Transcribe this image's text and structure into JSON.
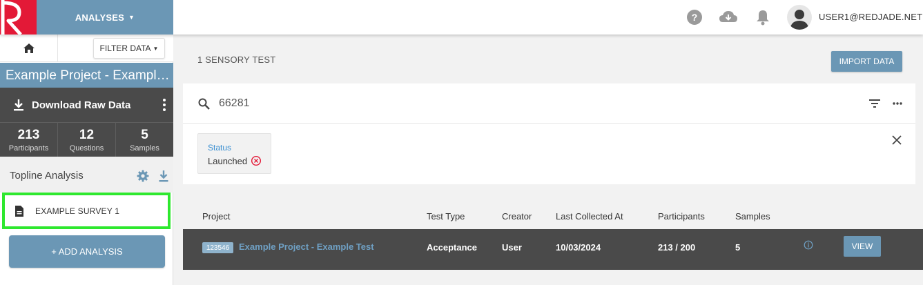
{
  "header": {
    "menu_label": "ANALYSES",
    "user": "USER1@REDJADE.NET",
    "brand_color": "#e31937",
    "accent_color": "#6b97b5"
  },
  "sidebar": {
    "filter_label": "FILTER DATA",
    "project_title": "Example Project - Example Test",
    "download_label": "Download Raw Data",
    "stats": [
      {
        "value": "213",
        "label": "Participants"
      },
      {
        "value": "12",
        "label": "Questions"
      },
      {
        "value": "5",
        "label": "Samples"
      }
    ],
    "section_label": "Topline Analysis",
    "survey_item": "EXAMPLE SURVEY 1",
    "add_label": "+ ADD ANALYSIS"
  },
  "main": {
    "count_label": "1 SENSORY TEST",
    "import_label": "IMPORT DATA",
    "search_value": "66281",
    "filter_chip": {
      "label": "Status",
      "value": "Launched"
    },
    "columns": [
      "Project",
      "Test Type",
      "Creator",
      "Last Collected At",
      "Participants",
      "Samples"
    ],
    "rows": [
      {
        "id": "123546",
        "project": "Example Project - Example Test",
        "test_type": "Acceptance",
        "creator": "User",
        "last_collected": "10/03/2024",
        "participants": "213 / 200",
        "samples": "5",
        "action": "VIEW"
      }
    ]
  }
}
